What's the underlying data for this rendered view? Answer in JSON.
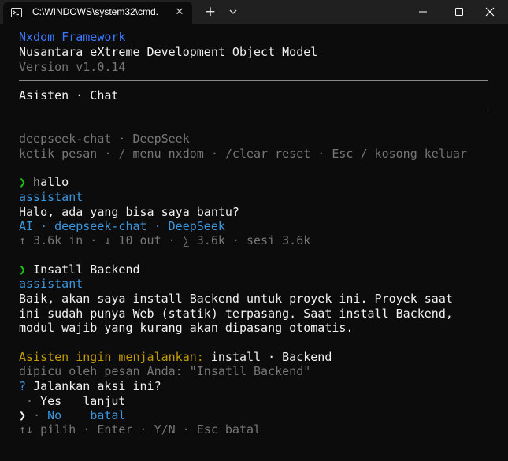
{
  "window": {
    "tab_title": "C:\\WINDOWS\\system32\\cmd.",
    "new_tab_label": "+",
    "close_tab_label": "✕"
  },
  "header": {
    "framework_name": "Nxdom Framework",
    "framework_subtitle": "Nusantara eXtreme Development Object Model",
    "version": "Version v1.0.14",
    "mode_title": "Asisten · Chat"
  },
  "session": {
    "model_line": "deepseek-chat · DeepSeek",
    "help_line": "ketik pesan · / menu nxdom · /clear reset · Esc / kosong keluar"
  },
  "conversation": [
    {
      "prompt_marker": "❯",
      "user_message": "hallo",
      "role": "assistant",
      "reply_lines": [
        "Halo, ada yang bisa saya bantu?"
      ],
      "meta": "AI · deepseek-chat · DeepSeek",
      "stats": "↑ 3.6k in · ↓ 10 out · ∑ 3.6k · sesi 3.6k"
    },
    {
      "prompt_marker": "❯",
      "user_message": "Insatll Backend",
      "role": "assistant",
      "reply_lines": [
        "Baik, akan saya install Backend untuk proyek ini. Proyek saat",
        "ini sudah punya Web (statik) terpasang. Saat install Backend,",
        "modul wajib yang kurang akan dipasang otomatis."
      ]
    }
  ],
  "action": {
    "label": "Asisten ingin menjalankan:",
    "command": "install · Backend",
    "trigger": "dipicu oleh pesan Anda: \"Insatll Backend\"",
    "question_mark": "?",
    "question": "Jalankan aksi ini?",
    "options": [
      {
        "marker": "·",
        "label": "Yes",
        "desc": "lanjut",
        "selected": false
      },
      {
        "marker": "❯",
        "label": "No",
        "desc": "batal",
        "selected": true
      }
    ],
    "hint": "↑↓ pilih · Enter · Y/N · Esc batal"
  },
  "colors": {
    "background": "#0c0c0c",
    "titlebar": "#202020",
    "brand_blue": "#3b78ff",
    "prompt_green": "#16c60c",
    "role_cyan": "#3a96dd",
    "warning_yellow": "#c19c00",
    "muted_gray": "#767676"
  }
}
